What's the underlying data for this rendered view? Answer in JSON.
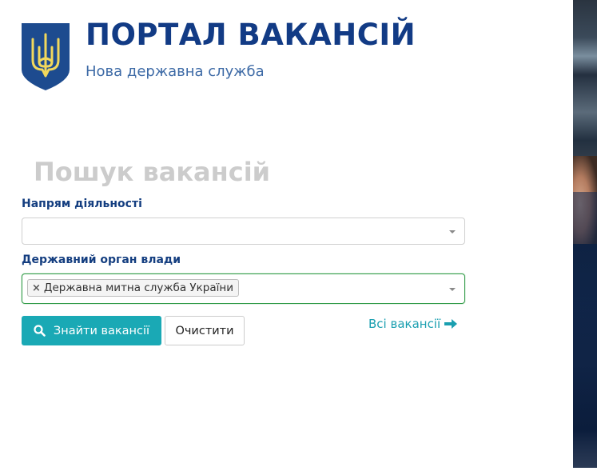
{
  "header": {
    "title": "ПОРТАЛ ВАКАНСІЙ",
    "subtitle": "Нова державна служба",
    "logo_icon": "ukraine-coat-of-arms",
    "colors": {
      "title": "#123b85",
      "subtitle": "#3d6aa6",
      "shield": "#1d4b8f",
      "trident": "#f2d85c"
    }
  },
  "search": {
    "heading": "Пошук вакансій",
    "direction": {
      "label": "Напрям діяльності",
      "value": ""
    },
    "authority": {
      "label": "Державний орган влади",
      "selected": [
        "Державна митна служба України"
      ]
    },
    "find_button": {
      "label": "Знайти вакансії",
      "icon": "search-icon",
      "color": "#1aa9b5"
    },
    "clear_button": {
      "label": "Очистити"
    },
    "all_vacancies_link": {
      "label": "Всі вакансії",
      "icon": "arrow-right-icon",
      "color": "#1a9fb0"
    }
  }
}
